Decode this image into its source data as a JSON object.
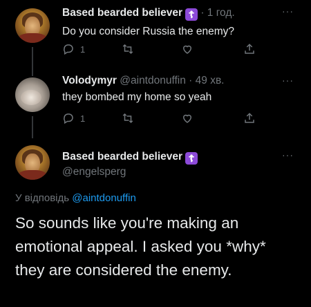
{
  "tweet1": {
    "author_name": "Based bearded believer",
    "badge": "☦",
    "time": "· 1 год.",
    "text": "Do you consider Russia the enemy?",
    "replies": "1",
    "more": "···"
  },
  "tweet2": {
    "author_name": "Volodymyr",
    "handle_time": "@aintdonuffin · 49 хв.",
    "text": "they bombed my home so yeah",
    "replies": "1",
    "more": "···"
  },
  "main_tweet": {
    "author_name": "Based bearded believer",
    "badge": "☦",
    "handle": "@engelsperg",
    "reply_prefix": "У відповідь ",
    "reply_handle": "@aintdonuffin",
    "text": "So sounds like you're making an emotional appeal. I asked you *why* they are considered the enemy.",
    "more": "···"
  },
  "icons": [
    "reply-icon",
    "retweet-icon",
    "like-icon",
    "share-icon",
    "more-icon"
  ],
  "colors": {
    "background": "#000000",
    "text": "#e7e9ea",
    "muted": "#71767b",
    "link": "#1d9bf0",
    "badge": "#8c4ad8"
  }
}
